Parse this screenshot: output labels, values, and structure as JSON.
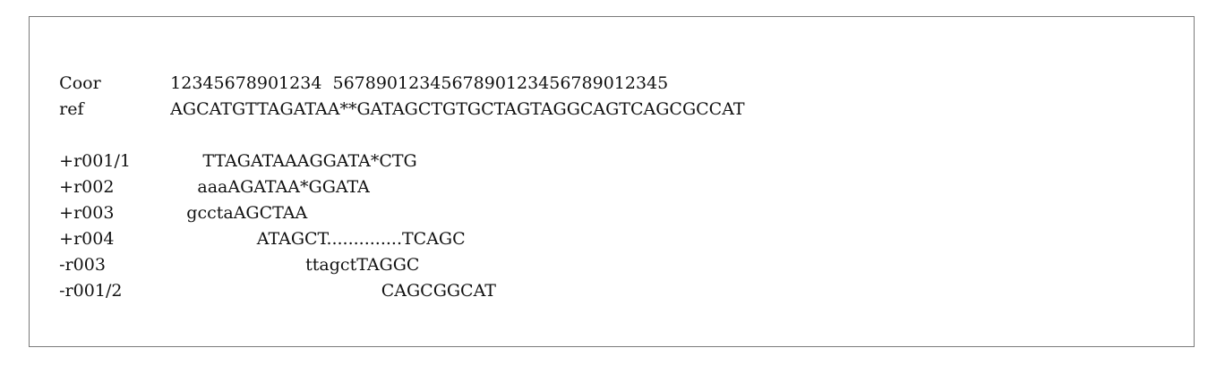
{
  "alignment": {
    "coor": {
      "label": "Coor",
      "seq": "12345678901234  5678901234567890123456789012345"
    },
    "ref": {
      "label": "ref",
      "seq": "AGCATGTTAGATAA**GATAGCTGTGCTAGTAGGCAGTCAGCGCCAT"
    },
    "reads": [
      {
        "label": "+r001/1",
        "seq": "      TTAGATAAAGGATA*CTG"
      },
      {
        "label": "+r002",
        "seq": "     aaaAGATAA*GGATA"
      },
      {
        "label": "+r003",
        "seq": "   gcctaAGCTAA"
      },
      {
        "label": "+r004",
        "seq": "                ATAGCT..............TCAGC"
      },
      {
        "label": "-r003",
        "seq": "                         ttagctTAGGC"
      },
      {
        "label": "-r001/2",
        "seq": "                                       CAGCGGCAT"
      }
    ]
  }
}
